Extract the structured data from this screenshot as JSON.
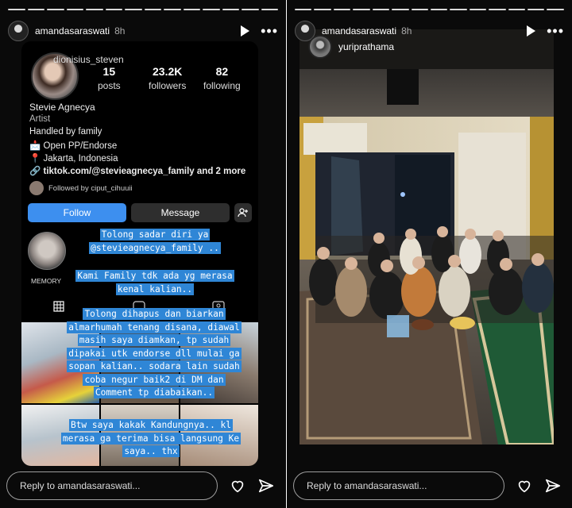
{
  "left_story": {
    "username": "amandasaraswati",
    "age": "8h",
    "reply_placeholder": "Reply to amandasaraswati...",
    "profile": {
      "handle": "dionisius_steven",
      "posts_count": "15",
      "posts_label": "posts",
      "followers_count": "23.2K",
      "followers_label": "followers",
      "following_count": "82",
      "following_label": "following",
      "name": "Stevie Agnecya",
      "category": "Artist",
      "bio_line1": "Handled by family",
      "bio_line2": "📩 Open PP/Endorse",
      "bio_line3": "📍 Jakarta, Indonesia",
      "bio_link": "🔗 tiktok.com/@stevieagnecya_family and 2 more",
      "followed_by": "Followed by ciput_cihuuii",
      "follow_label": "Follow",
      "message_label": "Message",
      "highlight_label": "MEMORY"
    },
    "overlay": {
      "block1_line1": "Tolong sadar diri ya",
      "block1_line2": "@stevieagnecya_family ..",
      "block2_line1": "Kami Family tdk ada yg merasa",
      "block2_line2": "kenal kalian..",
      "block3_line1": "Tolong dihapus dan biarkan",
      "block3_line2": "almarhumah tenang disana, diawal",
      "block3_line3": "masih saya diamkan, tp sudah",
      "block3_line4": "dipakai utk endorse dll mulai ga",
      "block3_line5": "sopan kalian.. sodara lain sudah",
      "block3_line6": "coba negur baik2 di DM dan",
      "block3_line7": "Comment tp diabaikan..",
      "block4_line1": "Btw saya kakak Kandungnya.. kl",
      "block4_line2": "merasa ga terima bisa langsung Ke",
      "block4_line3": "saya.. thx"
    }
  },
  "right_story": {
    "username": "amandasaraswati",
    "age": "8h",
    "mention": "yuriprathama",
    "reply_placeholder": "Reply to amandasaraswati..."
  },
  "colors": {
    "highlight_blue": "#2f86d6",
    "follow_blue": "#3d8fef",
    "background": "#0a0a0a"
  }
}
